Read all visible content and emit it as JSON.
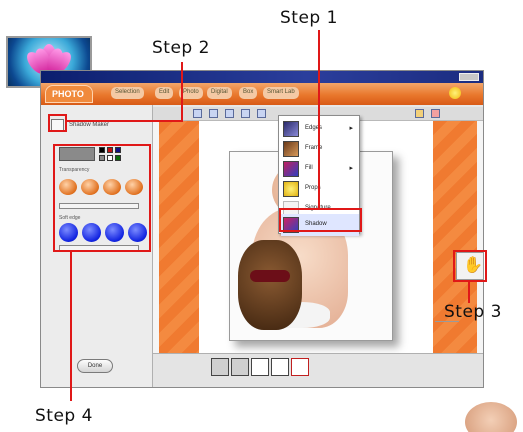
{
  "steps": {
    "step1": "Step 1",
    "step2": "Step 2",
    "step3": "Step 3",
    "step4": "Step 4"
  },
  "app": {
    "brand": "PHOTO",
    "menu_tabs": [
      "Selection",
      "Edit",
      "Photo",
      "Digital",
      "Box",
      "Smart Lab"
    ],
    "left_panel": {
      "shadow_tool_label": "Shadow Maker",
      "transparency_label": "Transparency",
      "softness_label": "Soft edge",
      "done_label": "Done"
    },
    "dropdown": {
      "items": [
        {
          "label": "Edges",
          "has_submenu": true,
          "icon": "edges-icon"
        },
        {
          "label": "Frame",
          "has_submenu": false,
          "icon": "frame-icon"
        },
        {
          "label": "Fill",
          "has_submenu": true,
          "icon": "fill-icon"
        },
        {
          "label": "Props",
          "has_submenu": false,
          "icon": "props-icon"
        },
        {
          "label": "Signature",
          "has_submenu": false,
          "icon": "signature-icon"
        },
        {
          "label": "Shadow",
          "has_submenu": false,
          "icon": "shadow-icon"
        }
      ],
      "selected": "Shadow",
      "submenu_arrow": "▸"
    }
  },
  "colors": {
    "highlight": "#e01818",
    "accent_orange": "#e9772c",
    "title_bar": "#0b1f6e"
  }
}
